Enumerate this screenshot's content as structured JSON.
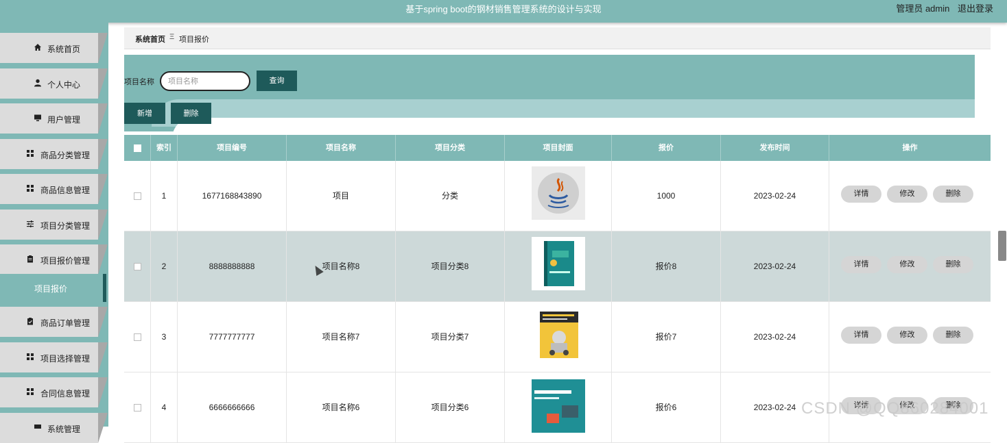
{
  "header": {
    "title": "基于spring boot的钢材销售管理系统的设计与实现",
    "user_label": "管理员 admin",
    "logout_label": "退出登录"
  },
  "sidebar": {
    "items": [
      {
        "label": "系统首页",
        "icon": "home-icon"
      },
      {
        "label": "个人中心",
        "icon": "user-icon"
      },
      {
        "label": "用户管理",
        "icon": "monitor-icon"
      },
      {
        "label": "商品分类管理",
        "icon": "grid-icon"
      },
      {
        "label": "商品信息管理",
        "icon": "grid-icon"
      },
      {
        "label": "项目分类管理",
        "icon": "sliders-icon"
      },
      {
        "label": "项目报价管理",
        "icon": "clipboard-icon"
      },
      {
        "label": "商品订单管理",
        "icon": "clipboard-check-icon"
      },
      {
        "label": "项目选择管理",
        "icon": "grid-icon"
      },
      {
        "label": "合同信息管理",
        "icon": "grid-icon"
      },
      {
        "label": "系统管理",
        "icon": "gear-icon"
      }
    ],
    "active_sub": "项目报价"
  },
  "breadcrumb": {
    "home": "系统首页",
    "separator": "Ξ",
    "current": "项目报价"
  },
  "search": {
    "label": "项目名称",
    "placeholder": "项目名称",
    "value": "",
    "query_button": "查询",
    "add_button": "新增",
    "delete_button": "删除"
  },
  "table": {
    "headers": [
      "索引",
      "项目编号",
      "项目名称",
      "项目分类",
      "项目封面",
      "报价",
      "发布时间",
      "操作"
    ],
    "rows": [
      {
        "index": "1",
        "code": "1677168843890",
        "name": "项目",
        "category": "分类",
        "cover": "java-logo",
        "price": "1000",
        "date": "2023-02-24"
      },
      {
        "index": "2",
        "code": "8888888888",
        "name": "项目名称8",
        "category": "项目分类8",
        "cover": "teal-book",
        "price": "报价8",
        "date": "2023-02-24"
      },
      {
        "index": "3",
        "code": "7777777777",
        "name": "项目名称7",
        "category": "项目分类7",
        "cover": "yellow-book",
        "price": "报价7",
        "date": "2023-02-24"
      },
      {
        "index": "4",
        "code": "6666666666",
        "name": "项目名称6",
        "category": "项目分类6",
        "cover": "scratch-book",
        "price": "报价6",
        "date": "2023-02-24"
      }
    ],
    "actions": {
      "detail": "详情",
      "edit": "修改",
      "delete": "删除"
    }
  },
  "watermark": "CSDN @QQ860284001",
  "colors": {
    "primary": "#7fb8b5",
    "dark": "#1e5a5a",
    "menu_bg": "#dcdcdc",
    "row_highlight": "#cdd9d9"
  }
}
